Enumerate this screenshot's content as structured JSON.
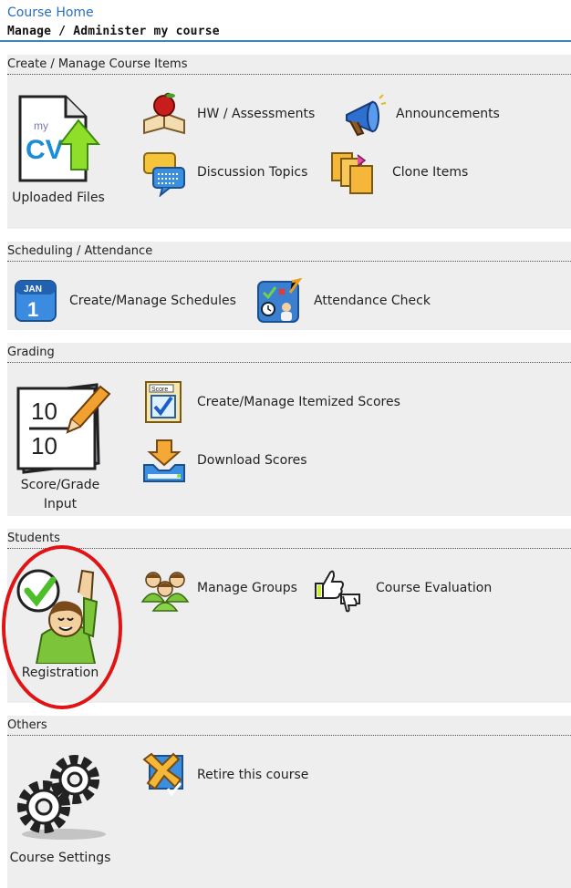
{
  "breadcrumb": {
    "home_link": "Course Home"
  },
  "page": {
    "title": "Manage / Administer my course"
  },
  "sections": {
    "create": {
      "title": "Create / Manage Course Items",
      "uploaded_files": "Uploaded Files",
      "hw_assessments": "HW / Assessments",
      "announcements": "Announcements",
      "discussion_topics": "Discussion Topics",
      "clone_items": "Clone Items"
    },
    "scheduling": {
      "title": "Scheduling / Attendance",
      "schedules": "Create/Manage Schedules",
      "attendance": "Attendance Check",
      "calendar_month": "JAN",
      "calendar_day": "1"
    },
    "grading": {
      "title": "Grading",
      "score_input": "Score/Grade Input",
      "itemized_scores": "Create/Manage Itemized Scores",
      "download_scores": "Download Scores"
    },
    "students": {
      "title": "Students",
      "registration": "Registration",
      "manage_groups": "Manage Groups",
      "course_evaluation": "Course Evaluation"
    },
    "others": {
      "title": "Others",
      "course_settings": "Course Settings",
      "retire_course": "Retire this course"
    }
  },
  "icons": {
    "uploaded_files": "document-upload-icon",
    "hw": "apple-book-icon",
    "announcements": "megaphone-icon",
    "discussion": "chat-bubbles-icon",
    "clone": "clone-folders-icon",
    "calendar": "calendar-icon",
    "attendance": "attendance-board-icon",
    "score_input": "score-pad-icon",
    "itemized": "score-card-icon",
    "download": "download-tray-icon",
    "registration": "registration-student-icon",
    "groups": "group-icon",
    "evaluation": "thumbs-icon",
    "settings": "gears-icon",
    "retire": "retire-icon"
  },
  "colors": {
    "link": "#2a6fb8",
    "rule": "#3f86b4",
    "panel": "#eeeeee",
    "highlight": "#e01414"
  }
}
